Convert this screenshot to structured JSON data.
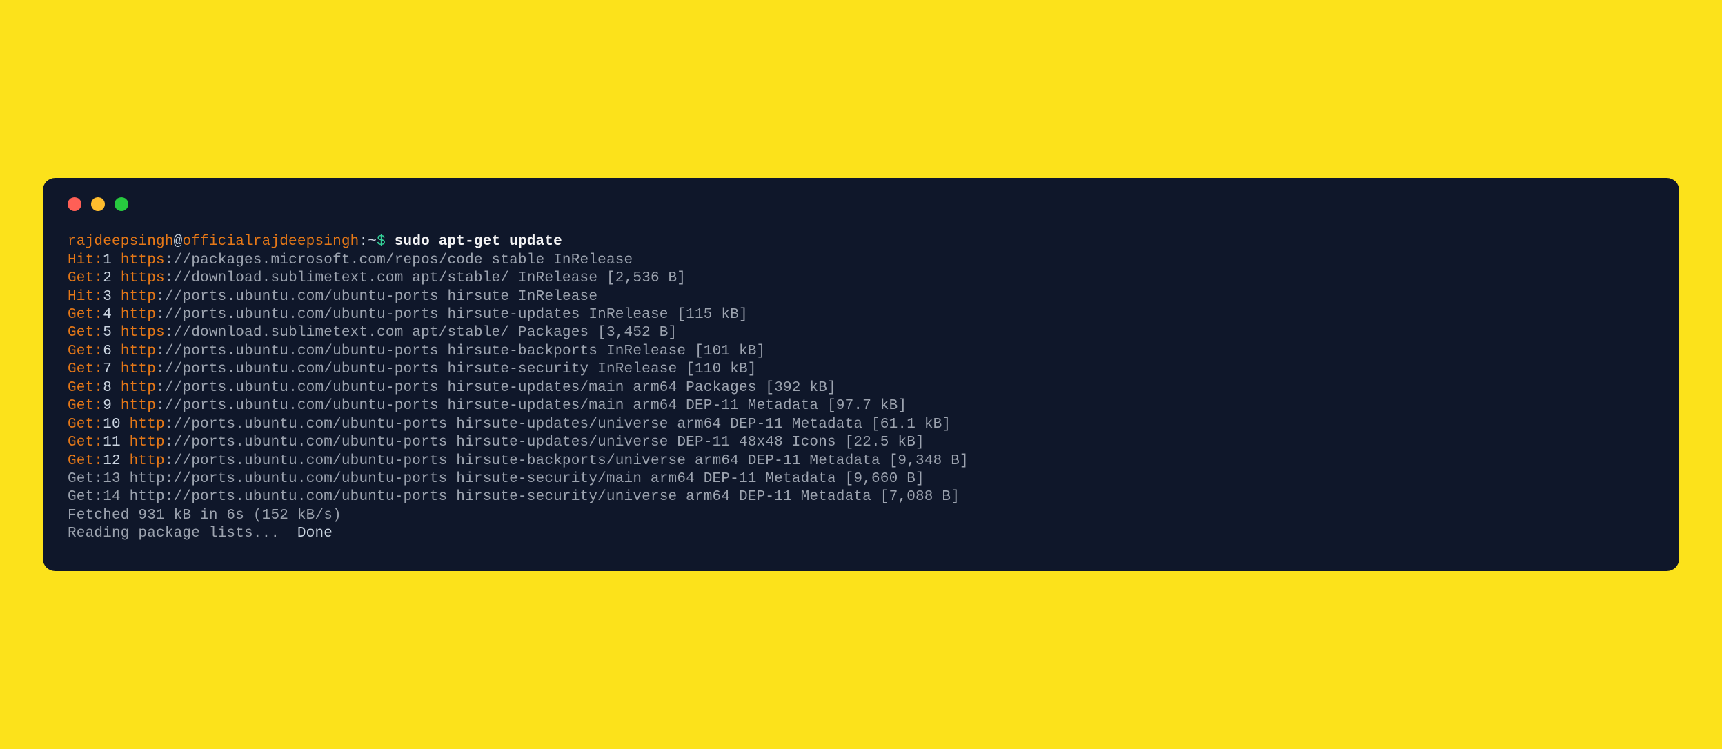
{
  "prompt": {
    "user": "rajdeepsingh",
    "at": "@",
    "host": "officialrajdeepsingh",
    "path": ":~",
    "dollar": "$",
    "command": "sudo apt-get update"
  },
  "lines": [
    {
      "action": "Hit:",
      "idx": "1",
      "scheme": "https",
      "rest": "://packages.microsoft.com/repos/code stable InRelease"
    },
    {
      "action": "Get:",
      "idx": "2",
      "scheme": "https",
      "rest": "://download.sublimetext.com apt/stable/ InRelease [2,536 B]"
    },
    {
      "action": "Hit:",
      "idx": "3",
      "scheme": "http",
      "rest": "://ports.ubuntu.com/ubuntu-ports hirsute InRelease"
    },
    {
      "action": "Get:",
      "idx": "4",
      "scheme": "http",
      "rest": "://ports.ubuntu.com/ubuntu-ports hirsute-updates InRelease [115 kB]"
    },
    {
      "action": "Get:",
      "idx": "5",
      "scheme": "https",
      "rest": "://download.sublimetext.com apt/stable/ Packages [3,452 B]"
    },
    {
      "action": "Get:",
      "idx": "6",
      "scheme": "http",
      "rest": "://ports.ubuntu.com/ubuntu-ports hirsute-backports InRelease [101 kB]"
    },
    {
      "action": "Get:",
      "idx": "7",
      "scheme": "http",
      "rest": "://ports.ubuntu.com/ubuntu-ports hirsute-security InRelease [110 kB]"
    },
    {
      "action": "Get:",
      "idx": "8",
      "scheme": "http",
      "rest": "://ports.ubuntu.com/ubuntu-ports hirsute-updates/main arm64 Packages [392 kB]"
    },
    {
      "action": "Get:",
      "idx": "9",
      "scheme": "http",
      "rest": "://ports.ubuntu.com/ubuntu-ports hirsute-updates/main arm64 DEP-11 Metadata [97.7 kB]"
    },
    {
      "action": "Get:",
      "idx": "10",
      "scheme": "http",
      "rest": "://ports.ubuntu.com/ubuntu-ports hirsute-updates/universe arm64 DEP-11 Metadata [61.1 kB]"
    },
    {
      "action": "Get:",
      "idx": "11",
      "scheme": "http",
      "rest": "://ports.ubuntu.com/ubuntu-ports hirsute-updates/universe DEP-11 48x48 Icons [22.5 kB]"
    },
    {
      "action": "Get:",
      "idx": "12",
      "scheme": "http",
      "rest": "://ports.ubuntu.com/ubuntu-ports hirsute-backports/universe arm64 DEP-11 Metadata [9,348 B]"
    },
    {
      "plain": "Get:13 http://ports.ubuntu.com/ubuntu-ports hirsute-security/main arm64 DEP-11 Metadata [9,660 B]"
    },
    {
      "plain": "Get:14 http://ports.ubuntu.com/ubuntu-ports hirsute-security/universe arm64 DEP-11 Metadata [7,088 B]"
    }
  ],
  "footer": {
    "fetched": "Fetched 931 kB in 6s (152 kB/s)",
    "reading_prefix": "Reading package lists...  ",
    "reading_done": "Done"
  }
}
